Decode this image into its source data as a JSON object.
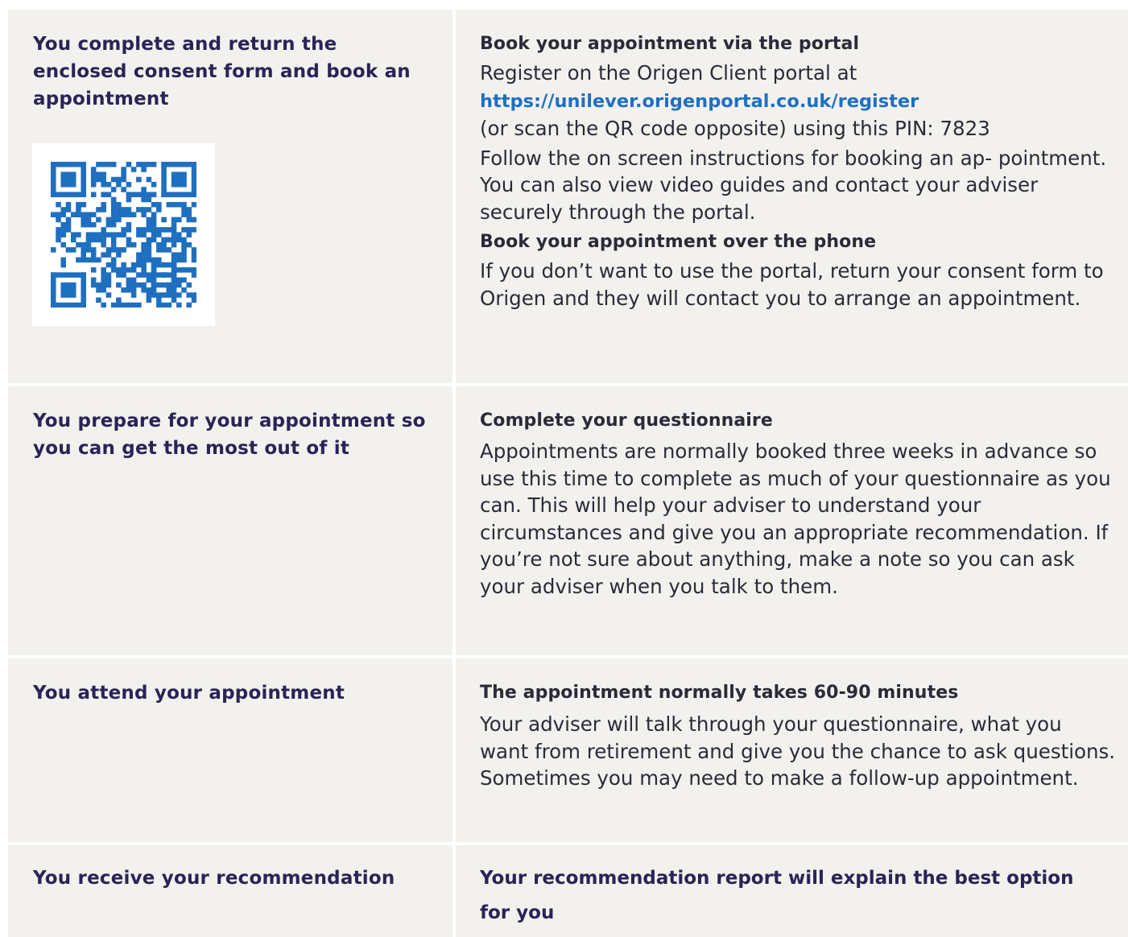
{
  "rows": [
    {
      "step": "You complete and return the enclosed consent form and book an appointment",
      "sections": [
        {
          "heading": "Book your appointment via the portal",
          "line1": "Register on the Origen Client portal at",
          "link": "https://unilever.origenportal.co.uk/register",
          "line2": "(or scan the QR code opposite) using this PIN: 7823",
          "para": "Follow the on screen instructions for booking an ap- pointment. You can also view video guides and contact your adviser securely through the portal."
        },
        {
          "heading": "Book your appointment over the phone",
          "para": "If you don’t want to use the portal, return your consent form to Origen and they will contact you to arrange an appointment."
        }
      ]
    },
    {
      "step": "You prepare for your appointment so you can get the most out of it",
      "heading": "Complete your questionnaire",
      "para": "Appointments are normally booked three weeks in advance so use this time to complete as much of your questionnaire as you can. This will help your adviser to understand your circumstances and give you an appropriate recommendation. If you’re not sure about anything, make a note so you can ask your adviser when you talk to them."
    },
    {
      "step": "You attend your appointment",
      "heading": "The appointment normally takes 60-90 minutes",
      "para": "Your adviser will talk through your questionnaire, what you want from retirement and give you the chance to ask questions. Sometimes you may need to make a follow-up appointment."
    },
    {
      "step": "You receive your recommendation",
      "heading": "Your recommendation report will explain the best option for you"
    }
  ],
  "colors": {
    "panel": "#f2f1ee",
    "step_text": "#2b2356",
    "body_text": "#2c2a38",
    "link": "#1f6fc0",
    "qr": "#1f6fc0"
  }
}
